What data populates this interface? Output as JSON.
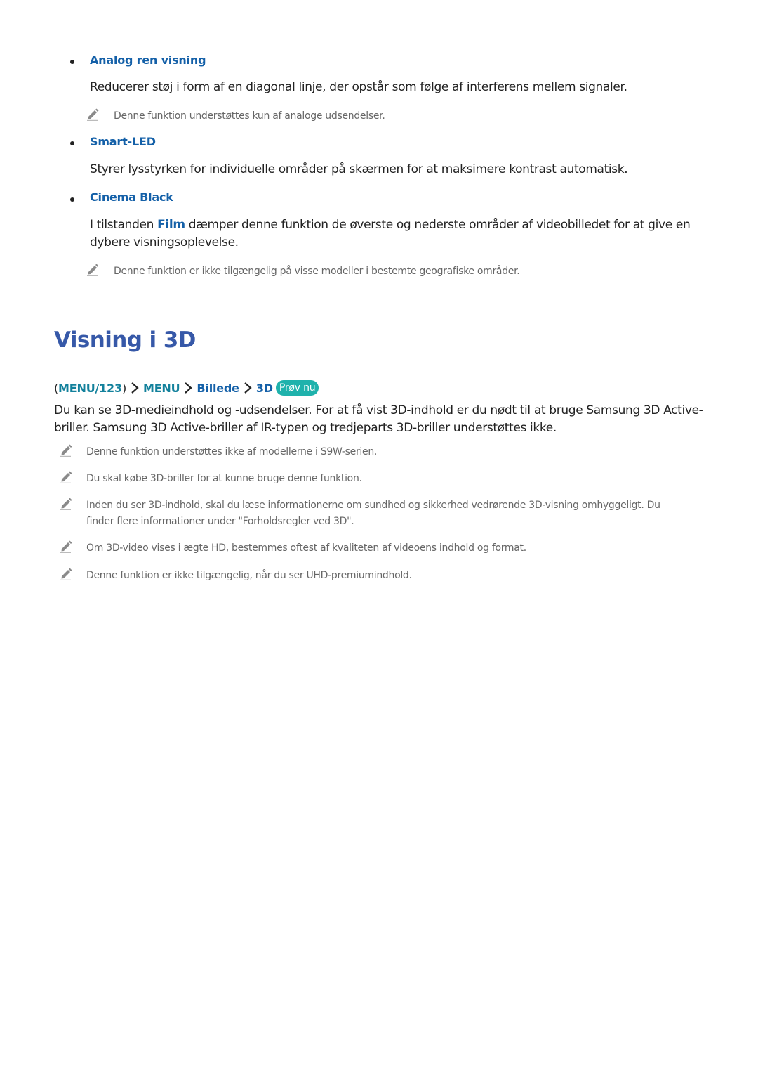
{
  "section1": {
    "items": [
      {
        "title": "Analog ren visning",
        "text": "Reducerer støj i form af en diagonal linje, der opstår som følge af interferens mellem signaler.",
        "note": "Denne funktion understøttes kun af analoge udsendelser."
      },
      {
        "title": "Smart-LED",
        "text": "Styrer lysstyrken for individuelle områder på skærmen for at maksimere kontrast automatisk."
      },
      {
        "title": "Cinema Black",
        "text_before": "I tilstanden ",
        "text_highlight": "Film",
        "text_after_line1": " dæmper denne funktion de øverste og nederste områder af videobilledet for at give en",
        "text_line2": "dybere visningsoplevelse.",
        "note": "Denne funktion er ikke tilgængelig på visse modeller i bestemte geografiske områder."
      }
    ]
  },
  "section2": {
    "heading": "Visning i 3D",
    "menu_path": {
      "open_paren": "(",
      "remote": "MENU/123",
      "close_paren": ")",
      "steps": [
        "MENU",
        "Billede",
        "3D"
      ],
      "try_now_label": "Prøv nu"
    },
    "intro_line1": "Du kan se 3D-medieindhold og -udsendelser. For at få vist 3D-indhold er du nødt til at bruge Samsung 3D Active-",
    "intro_line2": "briller. Samsung 3D Active-briller af IR-typen og tredjeparts 3D-briller understøttes ikke.",
    "notes": [
      "Denne funktion understøttes ikke af modellerne i S9W-serien.",
      "Du skal købe 3D-briller for at kunne bruge denne funktion.",
      "Inden du ser 3D-indhold, skal du læse informationerne om sundhed og sikkerhed vedrørende 3D-visning omhyggeligt. Du",
      "finder flere informationer under \"Forholdsregler ved 3D\".",
      "Om 3D-video vises i ægte HD, bestemmes oftest af kvaliteten af videoens indhold og format.",
      "Denne funktion er ikke tilgængelig, når du ser UHD-premiumindhold."
    ]
  },
  "colors": {
    "subheading": "#1460a8",
    "heading": "#3658a8",
    "menu_remote": "#13819c",
    "try_now_badge": "#1fb2ac",
    "note_text": "#666666",
    "body_text": "#222222"
  }
}
